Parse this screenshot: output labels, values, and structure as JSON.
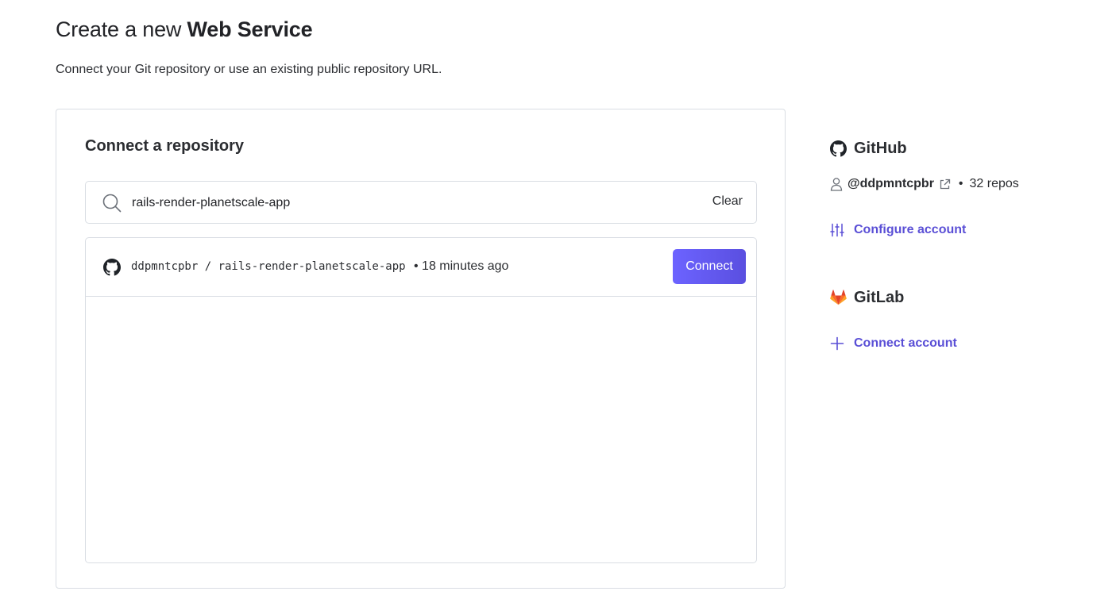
{
  "header": {
    "title_prefix": "Create a new ",
    "title_strong": "Web Service",
    "subtitle": "Connect your Git repository or use an existing public repository URL."
  },
  "connect_card": {
    "title": "Connect a repository",
    "search": {
      "value": "rails-render-planetscale-app",
      "clear_label": "Clear"
    },
    "results": [
      {
        "repo": "ddpmntcpbr / rails-render-planetscale-app",
        "meta": "• 18 minutes ago",
        "connect_label": "Connect"
      }
    ]
  },
  "sidebar": {
    "github": {
      "title": "GitHub",
      "handle": "@ddpmntcpbr",
      "separator": "•",
      "repos": "32 repos",
      "configure_label": "Configure account"
    },
    "gitlab": {
      "title": "GitLab",
      "connect_label": "Connect account"
    }
  },
  "colors": {
    "accent": "#5a4fd6",
    "button": "#6c63ff",
    "border": "#d9dde3",
    "gitlab_orange": "#fc6d26"
  }
}
